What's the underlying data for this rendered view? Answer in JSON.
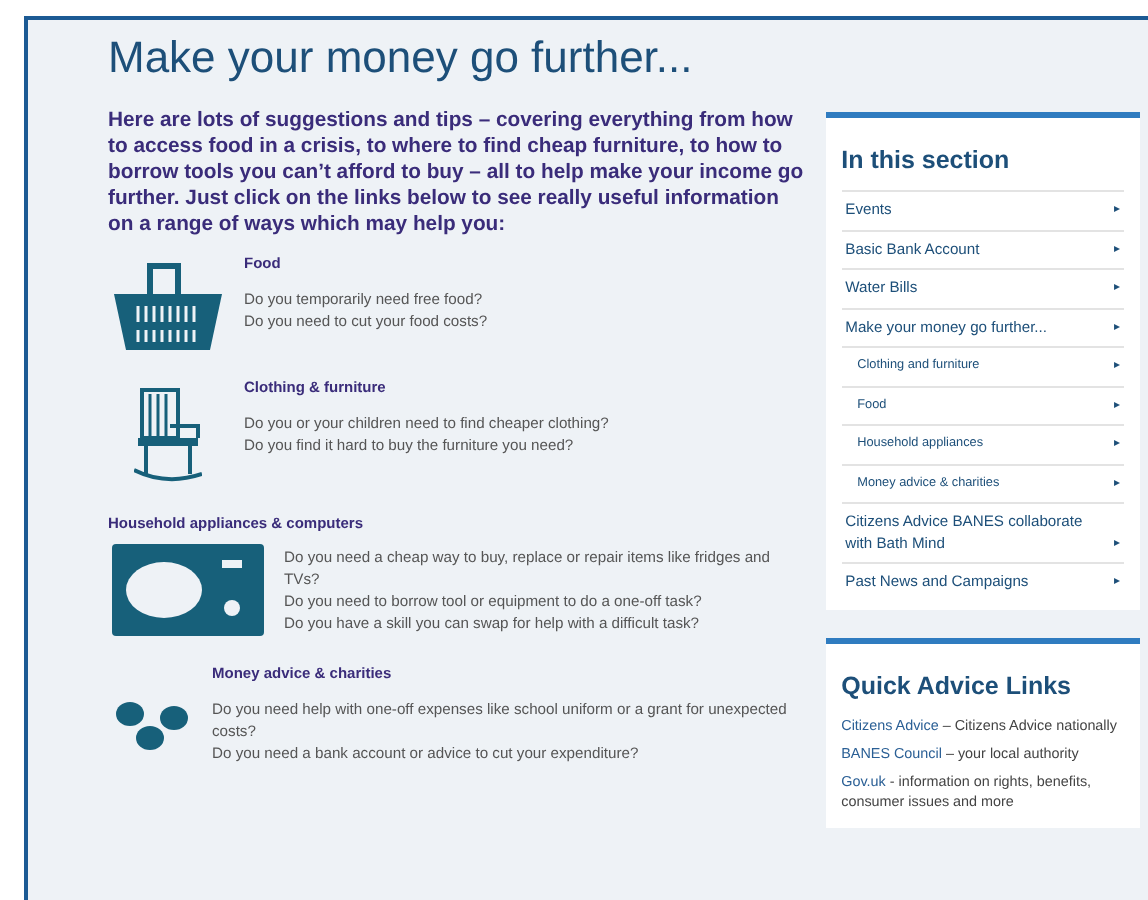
{
  "title": "Make your money go further...",
  "intro": "Here are lots of suggestions and tips – covering everything from how to access food in a crisis, to where to find cheap furniture, to how to borrow tools you can’t afford to buy – all to help make your income go further. Just click on the links below to see really useful information on a range of ways which may help you:",
  "sections": [
    {
      "kind": "basket",
      "heading_above": false,
      "heading": "Food",
      "lines": [
        "Do you temporarily need free food?",
        "Do you need to cut your food costs?"
      ]
    },
    {
      "kind": "chair",
      "heading_above": false,
      "heading": "Clothing & furniture",
      "lines": [
        "Do you or your children need to find cheaper clothing?",
        "Do you find it hard to buy the furniture you need?"
      ]
    },
    {
      "kind": "microwave",
      "heading_above": true,
      "heading": "Household appliances & computers",
      "lines": [
        "Do you need a cheap way to buy, replace or repair items like fridges and TVs?",
        "Do you need to borrow tool or equipment to do a one-off task?",
        "Do you have a skill you can swap for help with a difficult task?"
      ]
    },
    {
      "kind": "coins",
      "heading_above": false,
      "heading": "Money advice & charities",
      "lines": [
        "Do you need help with one-off expenses like school uniform or a grant for unexpected costs?",
        "Do you need a bank account or advice to cut your expenditure?"
      ]
    }
  ],
  "sidebar": {
    "title": "In this section",
    "items": [
      {
        "label": "Events",
        "arrow": "▸"
      },
      {
        "label": "Basic Bank Account",
        "arrow": "▸"
      },
      {
        "label": "Water Bills",
        "arrow": "▸"
      },
      {
        "label": "Make your money go further...",
        "arrow": "▸",
        "children": [
          {
            "label": "Clothing and furniture",
            "arrow": "▸"
          },
          {
            "label": "Food",
            "arrow": "▸"
          },
          {
            "label": "Household appliances",
            "arrow": "▸"
          },
          {
            "label": "Money advice & charities",
            "arrow": "▸"
          }
        ]
      },
      {
        "label": "Citizens Advice BANES collaborate with Bath Mind",
        "arrow": "▸"
      },
      {
        "label": "Past News and Campaigns",
        "arrow": "▸"
      }
    ]
  },
  "quick_links": {
    "title": "Quick Advice Links",
    "items": [
      {
        "link": "Citizens Advice",
        "text": "– Citizens Advice nationally"
      },
      {
        "link": "BANES Council",
        "text": "– your local authority"
      },
      {
        "link": "Gov.uk",
        "text": "- information on rights, benefits, consumer issues and more"
      }
    ]
  }
}
